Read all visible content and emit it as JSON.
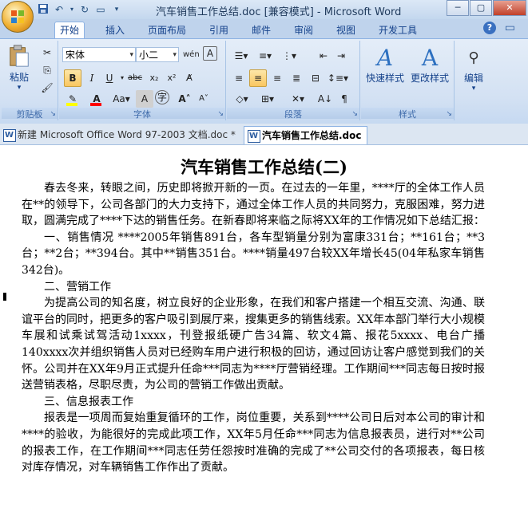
{
  "window": {
    "title": "汽车销售工作总结.doc [兼容模式] - Microsoft Word"
  },
  "qat": {
    "icons": [
      "word-icon",
      "save-icon",
      "undo-icon",
      "repeat-icon",
      "print-preview-icon",
      "customize-icon"
    ]
  },
  "tabs": [
    "开始",
    "插入",
    "页面布局",
    "引用",
    "邮件",
    "审阅",
    "视图",
    "开发工具"
  ],
  "ribbon": {
    "clipboard": {
      "paste_label": "粘贴",
      "group_label": "剪贴板"
    },
    "font": {
      "font_name": "宋体",
      "font_size": "小二",
      "group_label": "字体"
    },
    "paragraph": {
      "group_label": "段落"
    },
    "styles": {
      "quick_styles_label": "快速样式",
      "change_styles_label": "更改样式",
      "group_label": "样式"
    },
    "editing": {
      "label": "编辑"
    }
  },
  "doc_tabs": [
    "新建 Microsoft Office Word 97-2003 文档.doc *",
    "汽车销售工作总结.doc"
  ],
  "document": {
    "title": "汽车销售工作总结(二)",
    "paragraphs": [
      "春去冬来，转眼之间，历史即将掀开新的一页。在过去的一年里，****厅的全体工作人员在**的领导下，公司各部门的大力支持下，通过全体工作人员的共同努力，克服困难，努力进取，圆满完成了****下达的销售任务。在新春即将来临之际将XX年的工作情况如下总结汇报：",
      "一、销售情况    ****2005年销售891台，各车型销量分别为富康331台；**161台；**3台；**2台；**394台。其中**销售351台。****销量497台较XX年增长45(04年私家车销售342台)。",
      "二、营销工作",
      "为提高公司的知名度，树立良好的企业形象，在我们和客户搭建一个相互交流、沟通、联谊平台的同时，把更多的客户吸引到展厅来，搜集更多的销售线索。XX年本部门举行大小规模车展和试乘试驾活动1xxxx，刊登报纸硬广告34篇、软文4篇、报花5xxxx、电台广播140xxxx次并组织销售人员对已经购车用户进行积极的回访，通过回访让客户感觉到我们的关怀。公司并在XX年9月正式提升任命***同志为****厅营销经理。工作期间***同志每日按时报送营销表格，尽职尽责，为公司的营销工作做出贡献。",
      "三、信息报表工作",
      "报表是一项周而复始重复循环的工作，岗位重要，关系到****公司日后对本公司的审计和****的验收，为能很好的完成此项工作，XX年5月任命***同志为信息报表员，进行对**公司的报表工作，在工作期间***同志任劳任怨按时准确的完成了**公司交付的各项报表，每日核对库存情况，对车辆销售工作作出了贡献。"
    ]
  }
}
